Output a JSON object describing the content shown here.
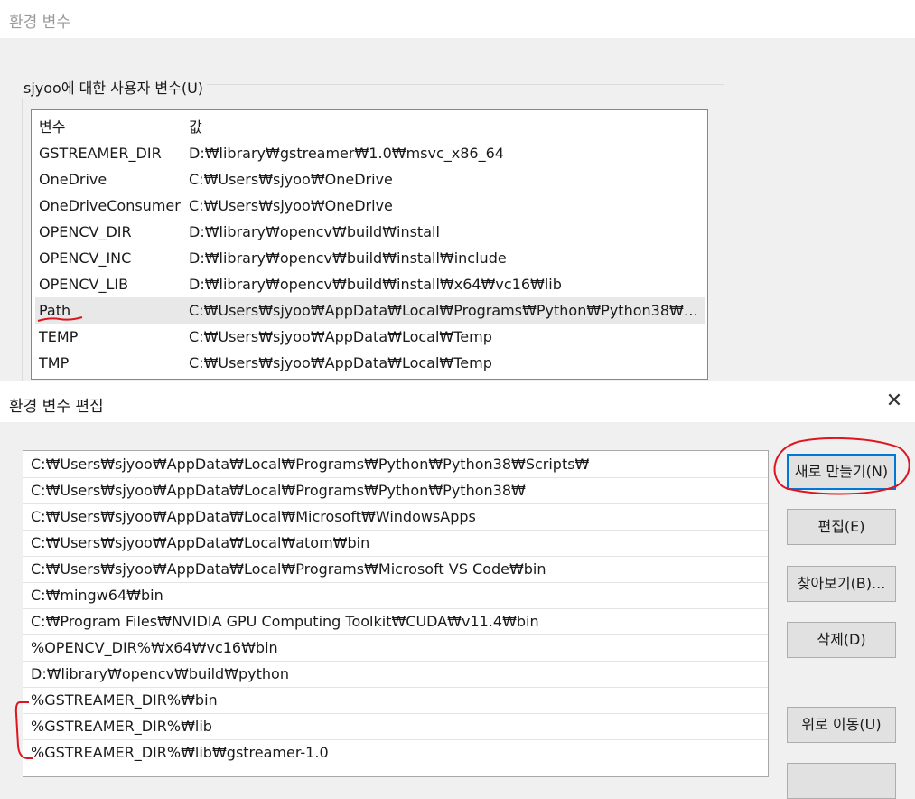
{
  "outer_window": {
    "title": "환경 변수"
  },
  "user_vars": {
    "group_label": "sjyoo에 대한 사용자 변수(U)",
    "headers": {
      "name": "변수",
      "value": "값"
    },
    "rows": [
      {
        "name": "GSTREAMER_DIR",
        "value": "D:₩library₩gstreamer₩1.0₩msvc_x86_64"
      },
      {
        "name": "OneDrive",
        "value": "C:₩Users₩sjyoo₩OneDrive"
      },
      {
        "name": "OneDriveConsumer",
        "value": "C:₩Users₩sjyoo₩OneDrive"
      },
      {
        "name": "OPENCV_DIR",
        "value": "D:₩library₩opencv₩build₩install"
      },
      {
        "name": "OPENCV_INC",
        "value": "D:₩library₩opencv₩build₩install₩include"
      },
      {
        "name": "OPENCV_LIB",
        "value": "D:₩library₩opencv₩build₩install₩x64₩vc16₩lib"
      },
      {
        "name": "Path",
        "value": "C:₩Users₩sjyoo₩AppData₩Local₩Programs₩Python₩Python38₩S..."
      },
      {
        "name": "TEMP",
        "value": "C:₩Users₩sjyoo₩AppData₩Local₩Temp"
      },
      {
        "name": "TMP",
        "value": "C:₩Users₩sjyoo₩AppData₩Local₩Temp"
      }
    ],
    "selected_row": "Path"
  },
  "edit_dialog": {
    "title": "환경 변수 편집",
    "close_glyph": "✕",
    "paths": [
      "C:₩Users₩sjyoo₩AppData₩Local₩Programs₩Python₩Python38₩Scripts₩",
      "C:₩Users₩sjyoo₩AppData₩Local₩Programs₩Python₩Python38₩",
      "C:₩Users₩sjyoo₩AppData₩Local₩Microsoft₩WindowsApps",
      "C:₩Users₩sjyoo₩AppData₩Local₩atom₩bin",
      "C:₩Users₩sjyoo₩AppData₩Local₩Programs₩Microsoft VS Code₩bin",
      "C:₩mingw64₩bin",
      "C:₩Program Files₩NVIDIA GPU Computing Toolkit₩CUDA₩v11.4₩bin",
      "%OPENCV_DIR%₩x64₩vc16₩bin",
      "D:₩library₩opencv₩build₩python",
      "%GSTREAMER_DIR%₩bin",
      "%GSTREAMER_DIR%₩lib",
      "%GSTREAMER_DIR%₩lib₩gstreamer-1.0"
    ],
    "buttons": {
      "new": "새로 만들기(N)",
      "edit": "편집(E)",
      "browse": "찾아보기(B)...",
      "delete": "삭제(D)",
      "move_up": "위로 이동(U)"
    }
  },
  "colors": {
    "annotation_red": "#e0141e",
    "focus_blue": "#0078d7"
  }
}
